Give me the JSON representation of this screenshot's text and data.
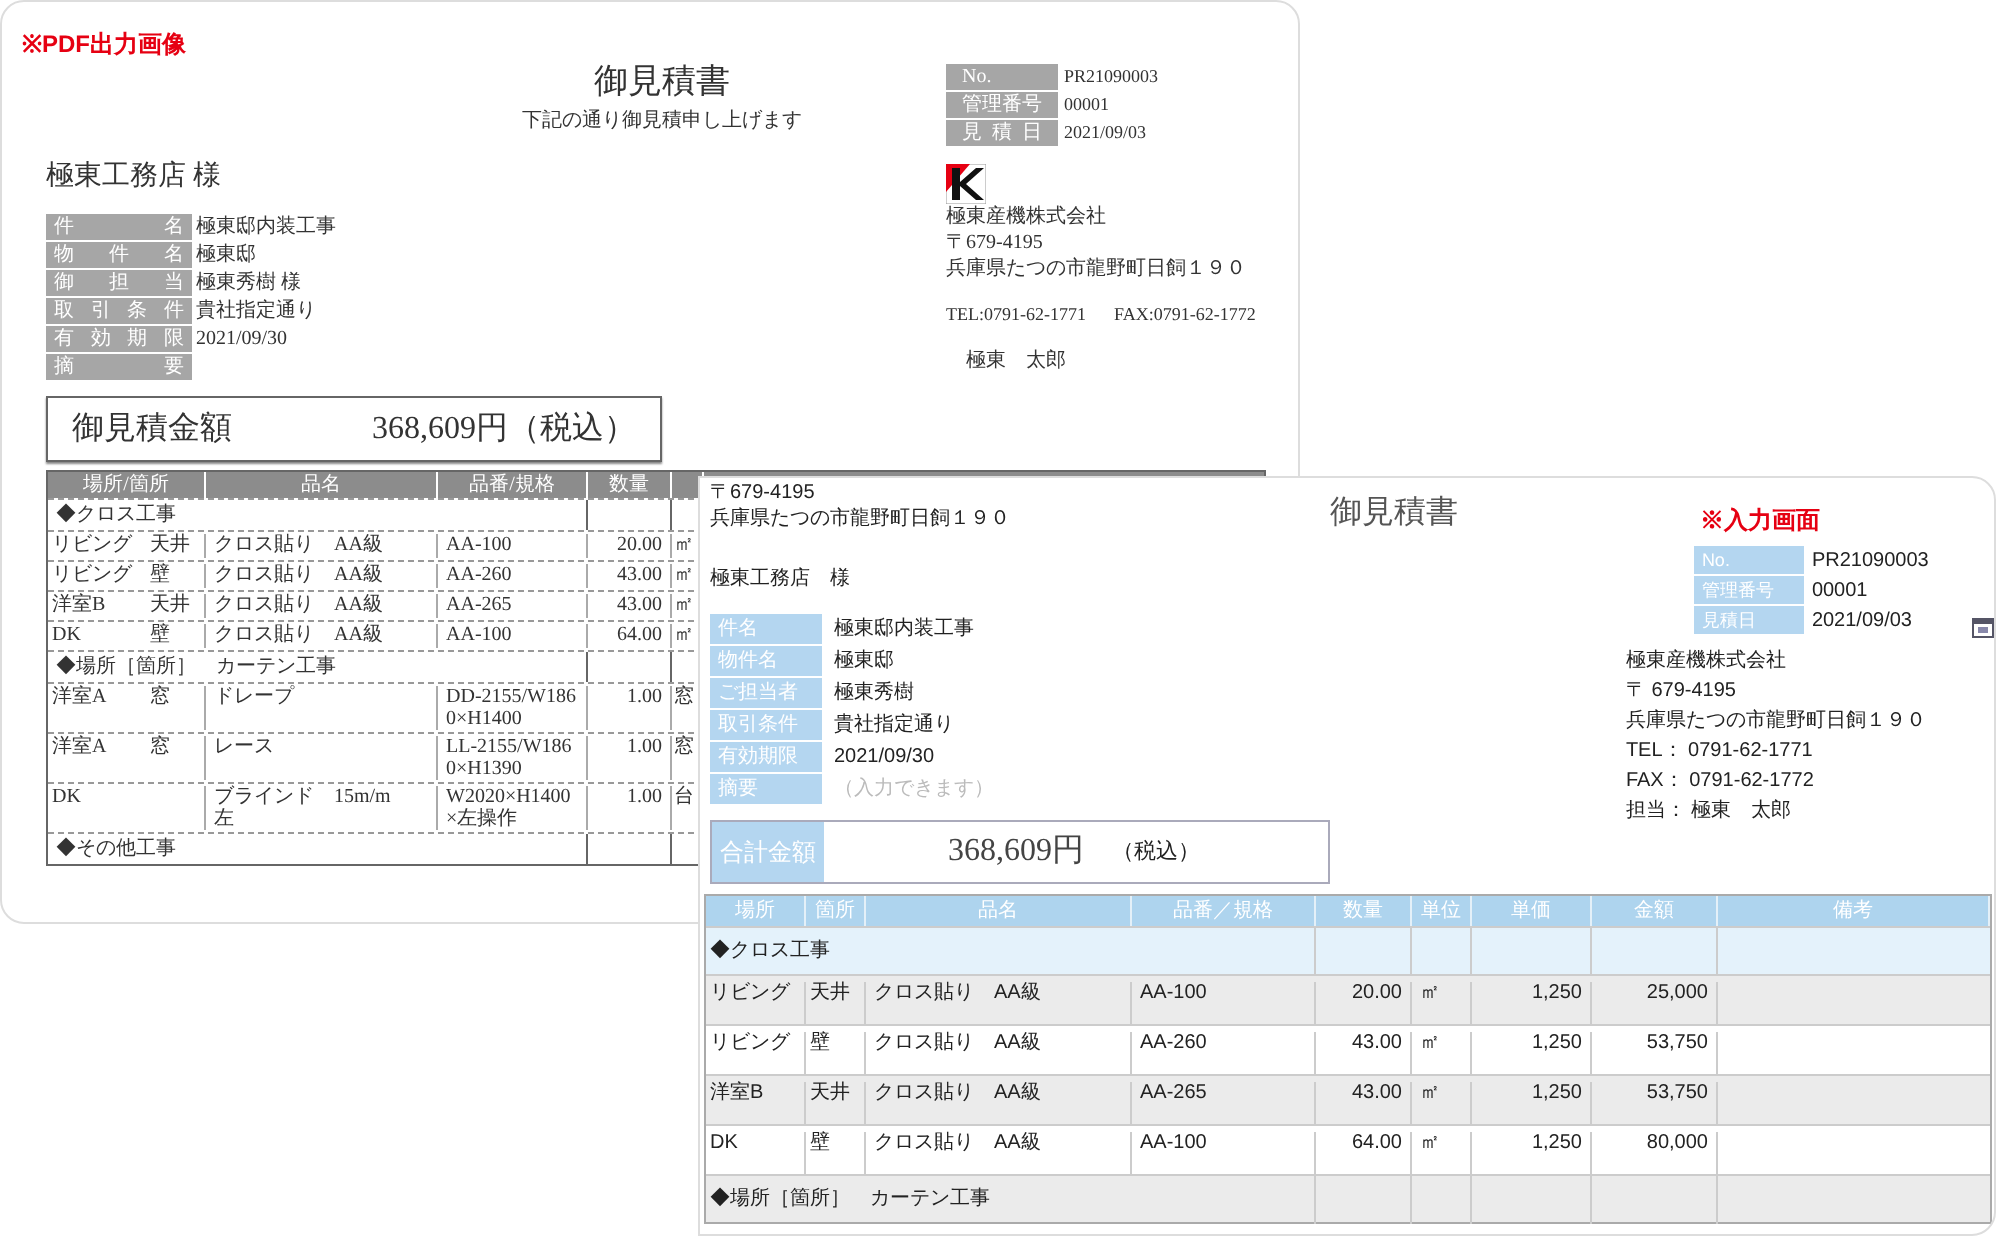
{
  "pdf_label": "※PDF出力画像",
  "pdf": {
    "title": "御見積書",
    "subtitle": "下記の通り御見積申し上げます",
    "customer": "極東工務店 様",
    "info": [
      {
        "label": "件名",
        "value": "極東邸内装工事"
      },
      {
        "label": "物件名",
        "value": "極東邸"
      },
      {
        "label": "御担当",
        "value": "極東秀樹 様"
      },
      {
        "label": "取引条件",
        "value": "貴社指定通り"
      },
      {
        "label": "有効期限",
        "value": "2021/09/30"
      },
      {
        "label": "摘要"
      }
    ],
    "meta": [
      {
        "label": "No.",
        "value": "PR21090003"
      },
      {
        "label": "管理番号",
        "value": "00001"
      },
      {
        "label": "見積日",
        "value": "2021/09/03"
      }
    ],
    "company": [
      "極東産機株式会社",
      "〒679-4195",
      "兵庫県たつの市龍野町日飼１９０"
    ],
    "tel": "TEL:0791-62-1771",
    "fax": "FAX:0791-62-1772",
    "person": "極東　太郎",
    "total": {
      "label": "御見積金額",
      "amount": "368,609円（税込）"
    },
    "table": {
      "columns": [
        "場所/箇所",
        "品名",
        "品番/規格",
        "数量"
      ],
      "rows": [
        {
          "kind": "section",
          "text": "◆クロス工事"
        },
        {
          "kind": "item",
          "place": "リビング",
          "spot": "天井",
          "name": "クロス貼り　AA級",
          "code": "AA-100",
          "qty": "20.00",
          "unit": "㎡"
        },
        {
          "kind": "item",
          "place": "リビング",
          "spot": "壁",
          "name": "クロス貼り　AA級",
          "code": "AA-260",
          "qty": "43.00",
          "unit": "㎡"
        },
        {
          "kind": "item",
          "place": "洋室B",
          "spot": "天井",
          "name": "クロス貼り　AA級",
          "code": "AA-265",
          "qty": "43.00",
          "unit": "㎡"
        },
        {
          "kind": "item",
          "place": "DK",
          "spot": "壁",
          "name": "クロス貼り　AA級",
          "code": "AA-100",
          "qty": "64.00",
          "unit": "㎡"
        },
        {
          "kind": "section",
          "text": "◆場所［箇所］　カーテン工事"
        },
        {
          "kind": "item",
          "place": "洋室A",
          "spot": "窓",
          "name": "ドレープ",
          "code": "DD-2155/W1860×H1400",
          "qty": "1.00",
          "unit": "窓"
        },
        {
          "kind": "item",
          "place": "洋室A",
          "spot": "窓",
          "name": "レース",
          "code": "LL-2155/W1860×H1390",
          "qty": "1.00",
          "unit": "窓"
        },
        {
          "kind": "item",
          "place": "DK",
          "name": "ブラインド　15m/m　左",
          "code": "W2020×H1400×左操作",
          "qty": "1.00",
          "unit": "台"
        },
        {
          "kind": "section",
          "text": "◆その他工事"
        }
      ]
    }
  },
  "input_label": "※入力画面",
  "input": {
    "postal_top": "〒679-4195",
    "address_top": "兵庫県たつの市龍野町日飼１９０",
    "title": "御見積書",
    "customer": "極東工務店　様",
    "info": [
      {
        "label": "件名",
        "value": "極東邸内装工事"
      },
      {
        "label": "物件名",
        "value": "極東邸"
      },
      {
        "label": "ご担当者",
        "value": "極東秀樹"
      },
      {
        "label": "取引条件",
        "value": "貴社指定通り"
      },
      {
        "label": "有効期限",
        "value": "2021/09/30"
      },
      {
        "label": "摘要",
        "placeholder": "（入力できます）"
      }
    ],
    "meta": [
      {
        "label": "No.",
        "value": "PR21090003"
      },
      {
        "label": "管理番号",
        "value": "00001"
      },
      {
        "label": "見積日",
        "value": "2021/09/03"
      }
    ],
    "company": [
      "極東産機株式会社",
      "〒 679-4195",
      "兵庫県たつの市龍野町日飼１９０",
      "TEL： 0791-62-1771",
      "FAX： 0791-62-1772",
      "担当： 極東　太郎"
    ],
    "total": {
      "label": "合計金額",
      "amount": "368,609円",
      "tax": "（税込）"
    },
    "table": {
      "columns": [
        "場所",
        "箇所",
        "品名",
        "品番／規格",
        "数量",
        "単位",
        "単価",
        "金額",
        "備考"
      ],
      "rows": [
        {
          "kind": "section",
          "text": "◆クロス工事"
        },
        {
          "kind": "item",
          "place": "リビング",
          "spot": "天井",
          "name": "クロス貼り　AA級",
          "code": "AA-100",
          "qty": "20.00",
          "unit": "㎡",
          "price": "1,250",
          "amount": "25,000"
        },
        {
          "kind": "item",
          "place": "リビング",
          "spot": "壁",
          "name": "クロス貼り　AA級",
          "code": "AA-260",
          "qty": "43.00",
          "unit": "㎡",
          "price": "1,250",
          "amount": "53,750"
        },
        {
          "kind": "item",
          "place": "洋室B",
          "spot": "天井",
          "name": "クロス貼り　AA級",
          "code": "AA-265",
          "qty": "43.00",
          "unit": "㎡",
          "price": "1,250",
          "amount": "53,750"
        },
        {
          "kind": "item",
          "place": "DK",
          "spot": "壁",
          "name": "クロス貼り　AA級",
          "code": "AA-100",
          "qty": "64.00",
          "unit": "㎡",
          "price": "1,250",
          "amount": "80,000"
        },
        {
          "kind": "section",
          "text": "◆場所［箇所］　カーテン工事"
        }
      ]
    }
  }
}
